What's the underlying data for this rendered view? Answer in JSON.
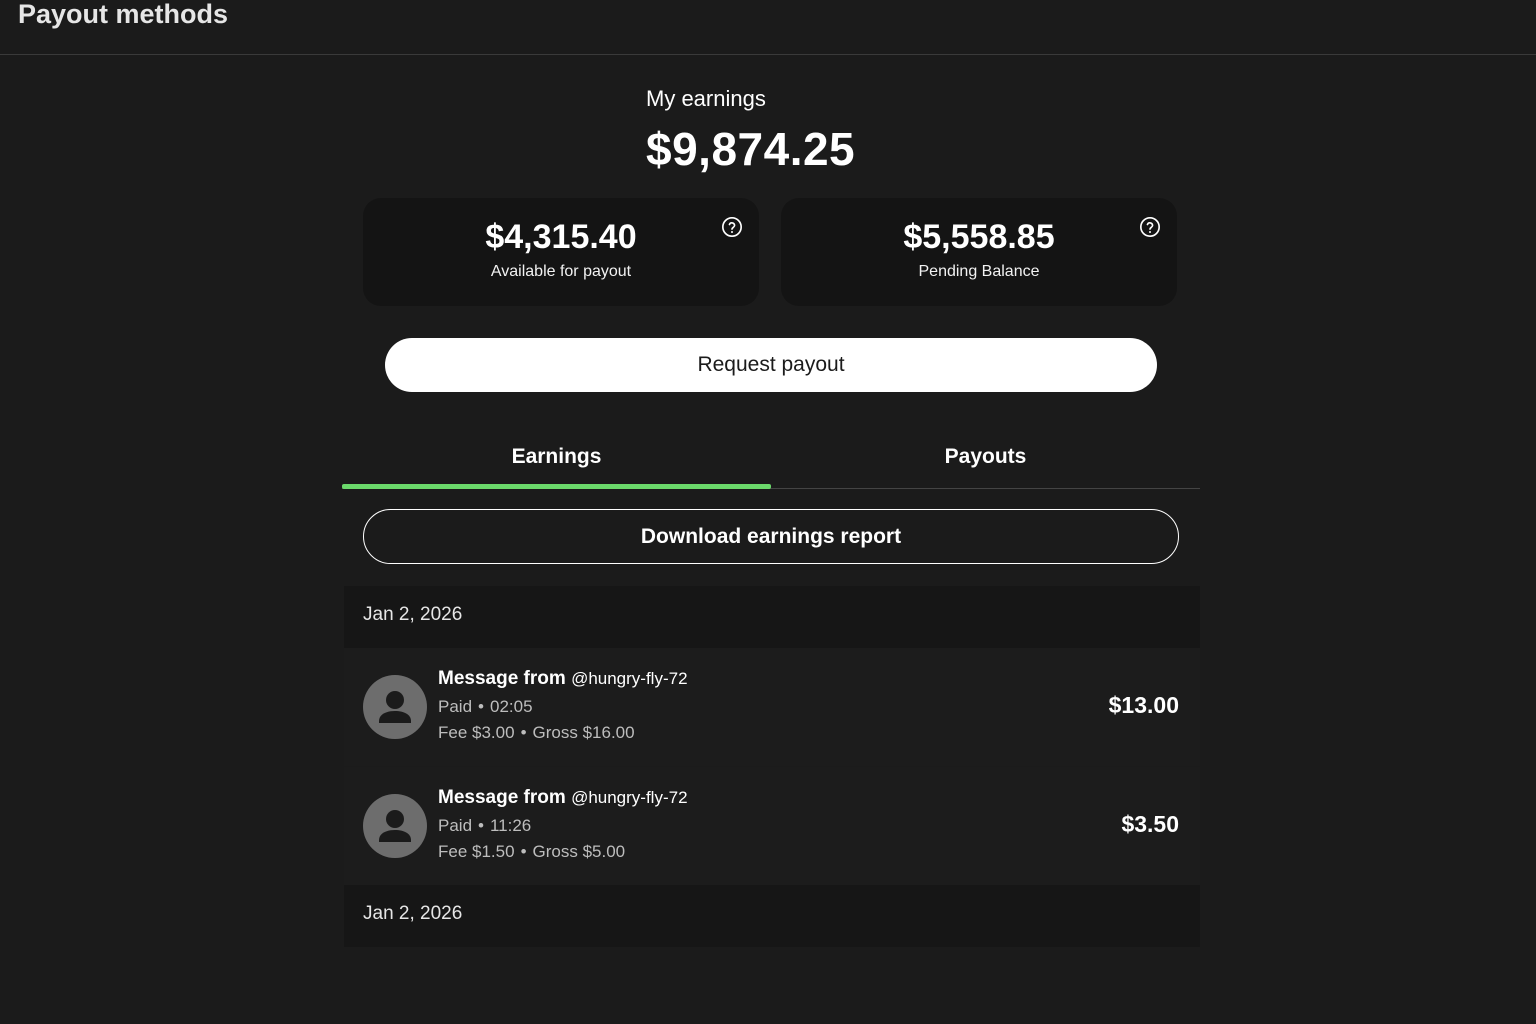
{
  "header": {
    "title": "Payout methods"
  },
  "earnings": {
    "label": "My earnings",
    "total": "$9,874.25"
  },
  "balances": {
    "available": {
      "amount": "$4,315.40",
      "caption": "Available for payout",
      "help_icon": "question-circle-icon"
    },
    "pending": {
      "amount": "$5,558.85",
      "caption": "Pending Balance",
      "help_icon": "question-circle-icon"
    }
  },
  "actions": {
    "request_payout": "Request payout",
    "download_report": "Download earnings report"
  },
  "tabs": [
    {
      "label": "Earnings",
      "active": true
    },
    {
      "label": "Payouts",
      "active": false
    }
  ],
  "groups": [
    {
      "date": "Jan 2, 2026",
      "transactions": [
        {
          "title": "Message from",
          "handle": "@hungry-fly-72",
          "status": "Paid",
          "time": "02:05",
          "fee": "Fee $3.00",
          "gross": "Gross $16.00",
          "net": "$13.00",
          "avatar_icon": "user-avatar-icon"
        },
        {
          "title": "Message from",
          "handle": "@hungry-fly-72",
          "status": "Paid",
          "time": "11:26",
          "fee": "Fee $1.50",
          "gross": "Gross $5.00",
          "net": "$3.50",
          "avatar_icon": "user-avatar-icon"
        }
      ]
    },
    {
      "date": "Jan 2, 2026",
      "transactions": []
    }
  ],
  "colors": {
    "background": "#1b1b1b",
    "card": "#141414",
    "accent_tab": "#6bd96b",
    "muted_text": "#bdbdbd"
  }
}
